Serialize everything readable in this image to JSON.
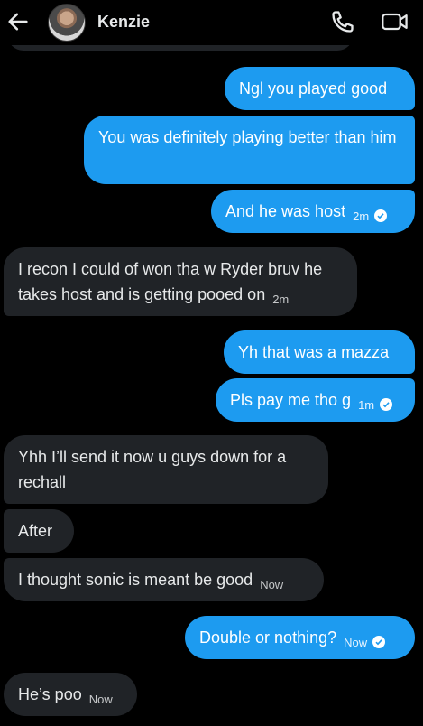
{
  "header": {
    "contact_name": "Kenzie"
  },
  "colors": {
    "outgoing": "#1d9bf0",
    "incoming": "#202327",
    "background": "#000000"
  },
  "messages": [
    {
      "dir": "out",
      "text": "Ngl you played good"
    },
    {
      "dir": "out",
      "text": "You was definitely playing better than him"
    },
    {
      "dir": "out",
      "text": "And he was host",
      "time": "2m",
      "read": true
    },
    {
      "dir": "in",
      "text": "I recon I could of won tha w Ryder bruv he takes host and is getting pooed on",
      "time": "2m"
    },
    {
      "dir": "out",
      "text": "Yh that was a mazza"
    },
    {
      "dir": "out",
      "text": "Pls pay me tho g",
      "time": "1m",
      "read": true
    },
    {
      "dir": "in",
      "text": "Yhh I’ll send it now u guys down for a rechall"
    },
    {
      "dir": "in",
      "text": "After"
    },
    {
      "dir": "in",
      "text": "I thought sonic is meant be good",
      "time": "Now"
    },
    {
      "dir": "out",
      "text": "Double or nothing?",
      "time": "Now",
      "read": true
    },
    {
      "dir": "in",
      "text": "He’s poo",
      "time": "Now"
    }
  ]
}
